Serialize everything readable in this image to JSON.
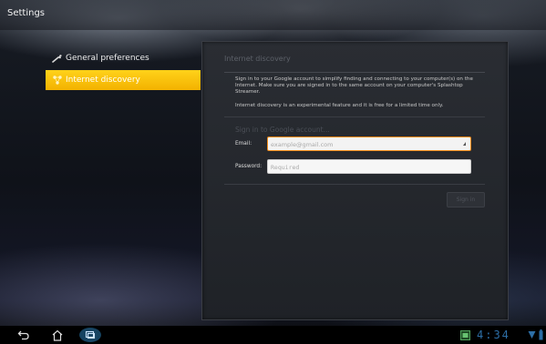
{
  "window": {
    "title": "Settings"
  },
  "nav": {
    "items": [
      {
        "label": "General preferences",
        "icon": "wrench-icon",
        "active": false
      },
      {
        "label": "Internet discovery",
        "icon": "network-icon",
        "active": true
      }
    ]
  },
  "panel": {
    "heading": "Internet discovery",
    "description": "Sign in to your Google account to simplify finding and connecting to your computer(s) on the Internet. Make sure you are signed in to the same account on your computer's Splashtop Streamer.",
    "note": "Internet discovery is an experimental feature and it is free for a limited time only.",
    "signin_title": "Sign in to Google account...",
    "email_label": "Email:",
    "email_placeholder": "example@gmail.com",
    "password_label": "Password:",
    "password_placeholder": "Required",
    "signin_button": "Sign in"
  },
  "system_bar": {
    "time": "4:34",
    "icons": [
      "back-icon",
      "home-icon",
      "recent-apps-icon",
      "screenshot-icon",
      "wifi-icon",
      "battery-icon"
    ],
    "accent": "#2d6ea6"
  },
  "colors": {
    "nav_active": "#f7c000",
    "email_focus_border": "#f08a16"
  }
}
